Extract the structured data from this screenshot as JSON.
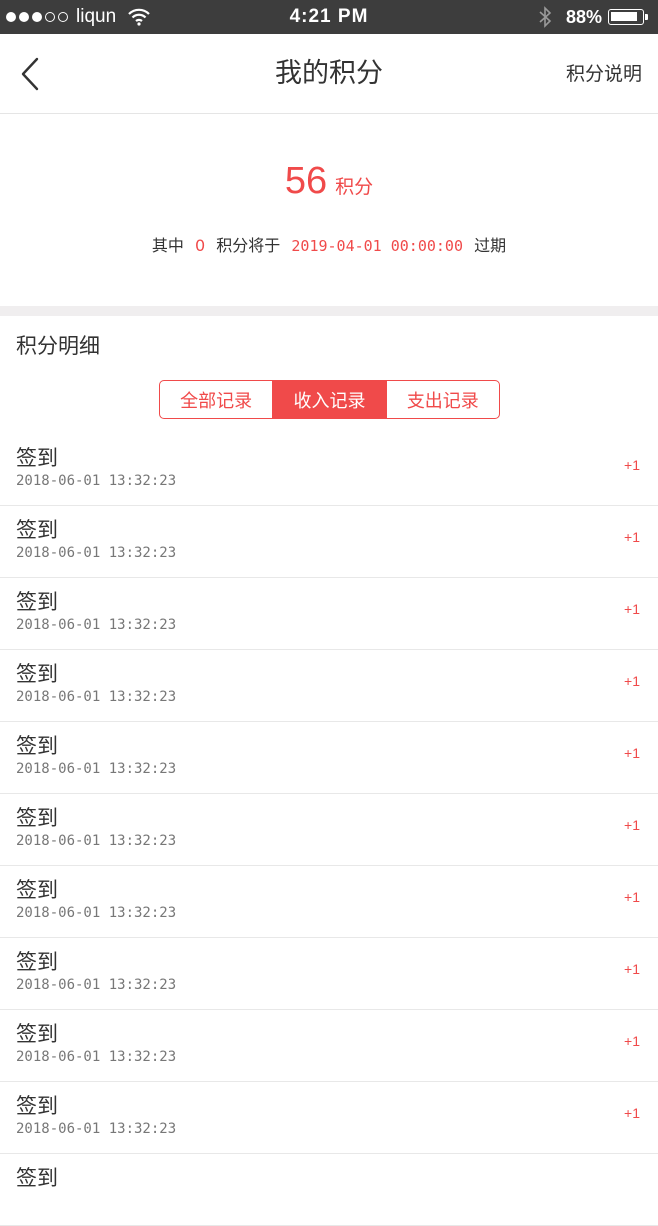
{
  "status_bar": {
    "carrier": "liqun",
    "time": "4:21 PM",
    "battery_percent": "88%",
    "battery_level": 0.88
  },
  "nav": {
    "title": "我的积分",
    "right_label": "积分说明",
    "back_icon": "chevron-left-icon"
  },
  "summary": {
    "points": "56",
    "points_unit": "积分",
    "expire_prefix": "其中",
    "expire_points": "0",
    "expire_middle": "积分将于",
    "expire_date": "2019-04-01 00:00:00",
    "expire_suffix": "过期"
  },
  "detail": {
    "title": "积分明细",
    "tabs": [
      {
        "label": "全部记录",
        "active": false
      },
      {
        "label": "收入记录",
        "active": true
      },
      {
        "label": "支出记录",
        "active": false
      }
    ]
  },
  "records": [
    {
      "title": "签到",
      "time": "2018-06-01 13:32:23",
      "amount": "+1"
    },
    {
      "title": "签到",
      "time": "2018-06-01 13:32:23",
      "amount": "+1"
    },
    {
      "title": "签到",
      "time": "2018-06-01 13:32:23",
      "amount": "+1"
    },
    {
      "title": "签到",
      "time": "2018-06-01 13:32:23",
      "amount": "+1"
    },
    {
      "title": "签到",
      "time": "2018-06-01 13:32:23",
      "amount": "+1"
    },
    {
      "title": "签到",
      "time": "2018-06-01 13:32:23",
      "amount": "+1"
    },
    {
      "title": "签到",
      "time": "2018-06-01 13:32:23",
      "amount": "+1"
    },
    {
      "title": "签到",
      "time": "2018-06-01 13:32:23",
      "amount": "+1"
    },
    {
      "title": "签到",
      "time": "2018-06-01 13:32:23",
      "amount": "+1"
    },
    {
      "title": "签到",
      "time": "2018-06-01 13:32:23",
      "amount": "+1"
    },
    {
      "title": "签到",
      "time": "",
      "amount": ""
    }
  ],
  "colors": {
    "accent": "#f04a4a",
    "status_bar_bg": "#3d3d3d",
    "section_divider": "#f0eeef"
  }
}
